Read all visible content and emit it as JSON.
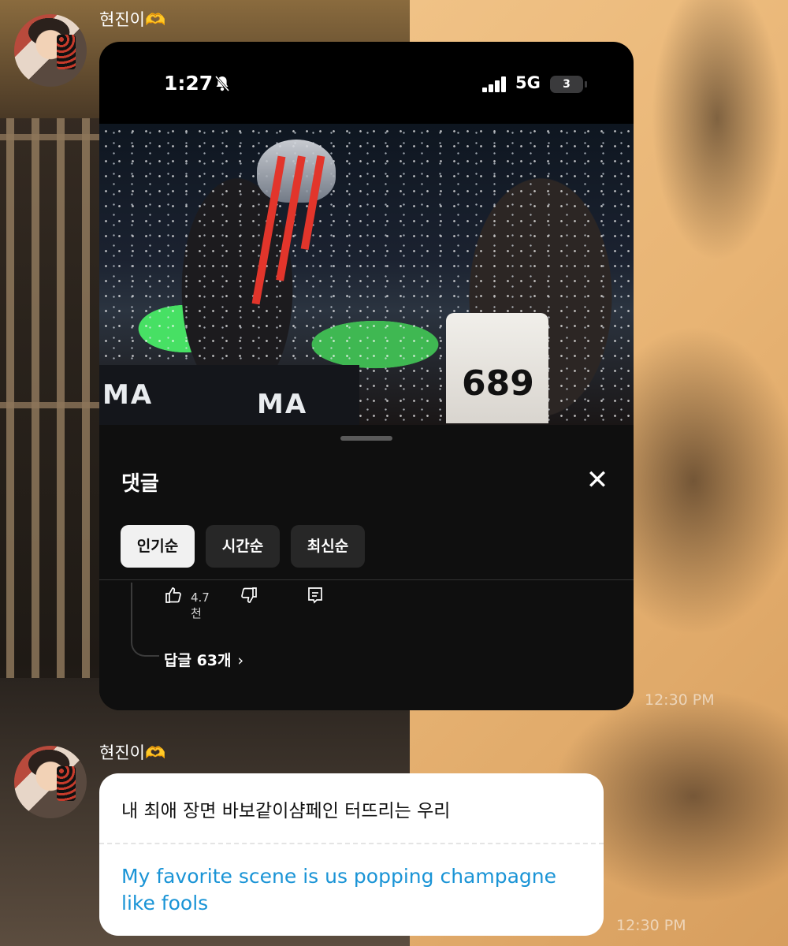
{
  "chat": {
    "sender_name": "현진이",
    "sender_emoji": "🫶",
    "messages": [
      {
        "type": "image",
        "time": "12:30 PM"
      },
      {
        "type": "text",
        "text": "내 최애 장면 바보같이샴페인 터뜨리는 우리",
        "translation": "My favorite scene is us popping champagne like fools",
        "time": "12:30 PM"
      }
    ]
  },
  "screenshot": {
    "status_bar": {
      "time": "1:27",
      "mute_icon": "bell-slash-icon",
      "network": "5G",
      "battery": "3"
    },
    "video_overlay_text": {
      "jersey_number": "689",
      "sign_text": "MA"
    },
    "comments_panel": {
      "title": "댓글",
      "close_icon": "close-icon",
      "tabs": [
        {
          "label": "인기순",
          "selected": true
        },
        {
          "label": "시간순",
          "selected": false
        },
        {
          "label": "최신순",
          "selected": false
        }
      ],
      "like_count": "4.7천",
      "replies_label": "답글 63개"
    }
  },
  "colors": {
    "translation_text": "#1a94d6",
    "heart": "#f1b43b",
    "panel_bg": "#0f0f0f"
  }
}
